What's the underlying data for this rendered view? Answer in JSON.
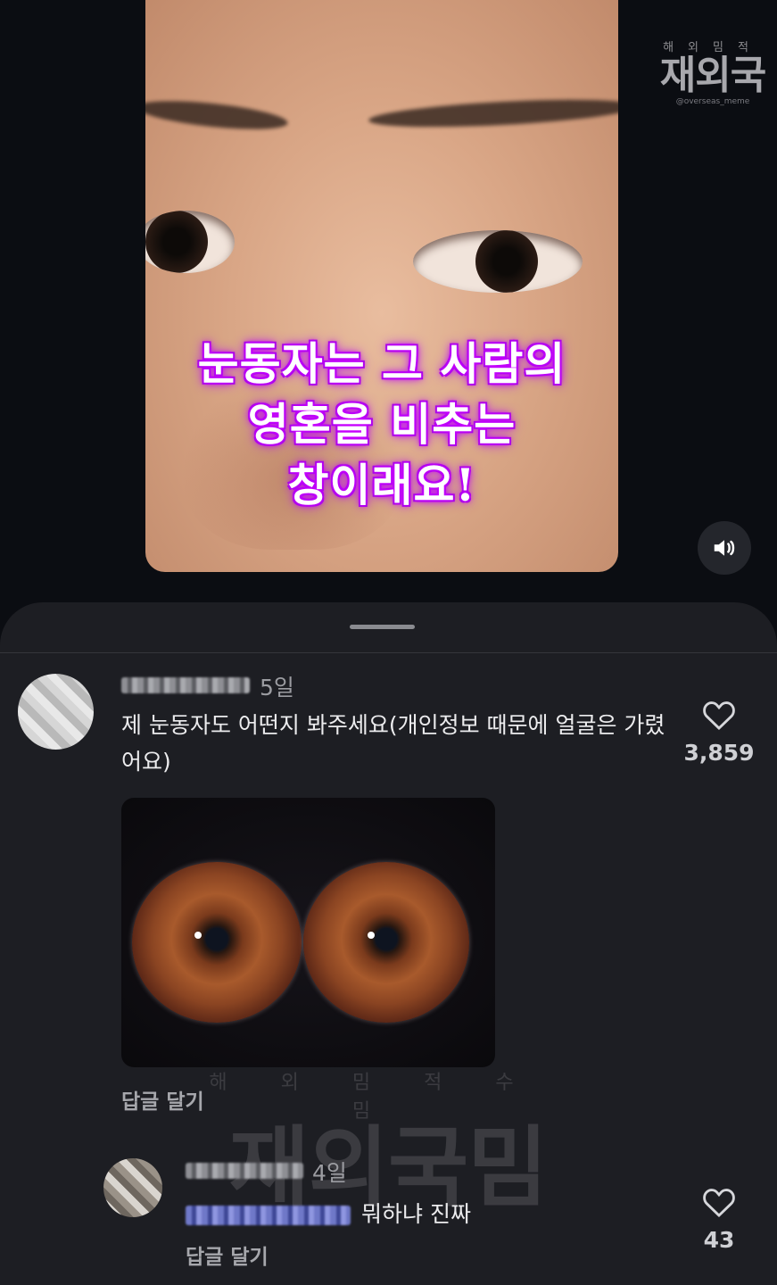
{
  "video": {
    "caption_lines": [
      "눈동자는 그 사람의",
      "영혼을 비추는",
      "창이래요!"
    ],
    "watermark": {
      "small": "해외밈적",
      "big": "재외국",
      "handle": "@overseas_meme"
    },
    "sound_icon": "speaker-icon"
  },
  "comments": [
    {
      "time": "5일",
      "text": "제 눈동자도 어떤지 봐주세요(개인정보 때문에 얼굴은 가렸어요)",
      "likes": "3,859",
      "reply_label": "답글 달기",
      "has_image": true
    },
    {
      "time": "4일",
      "text": "뭐하냐 진짜",
      "likes": "43",
      "reply_label": "답글 달기"
    }
  ],
  "mid_watermark": {
    "small": "해외밈적수밈",
    "big": "재외국밈"
  },
  "colors": {
    "caption_glow": "#c000ff",
    "sheet_bg": "#1d1e23",
    "page_bg": "#0b0d12",
    "mention": "#6f78c8"
  }
}
